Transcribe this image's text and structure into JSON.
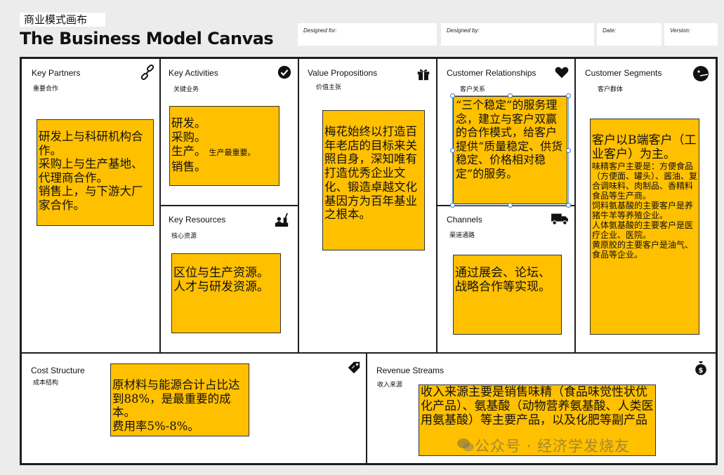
{
  "header": {
    "title_cn": "商业模式画布",
    "title_en": "The Business Model Canvas",
    "designed_for": "Designed for:",
    "designed_by": "Designed by:",
    "date": "Date:",
    "version": "Version:"
  },
  "sections": {
    "key_partners": {
      "title": "Key Partners",
      "cn": "重要合作",
      "icon": "link-icon"
    },
    "key_activities": {
      "title": "Key Activities",
      "cn": "关键业务",
      "icon": "check-circle-icon"
    },
    "key_resources": {
      "title": "Key Resources",
      "cn": "核心资源",
      "icon": "factory-worker-icon"
    },
    "value_propositions": {
      "title": "Value Propositions",
      "cn": "价值主张",
      "icon": "gift-icon"
    },
    "customer_relationships": {
      "title": "Customer Relationships",
      "cn": "客户关系",
      "icon": "heart-icon"
    },
    "channels": {
      "title": "Channels",
      "cn": "渠道通路",
      "icon": "truck-icon"
    },
    "customer_segments": {
      "title": "Customer Segments",
      "cn": "客户群体",
      "icon": "face-icon"
    },
    "cost_structure": {
      "title": "Cost Structure",
      "cn": "成本结构",
      "icon": "tag-icon"
    },
    "revenue_streams": {
      "title": "Revenue Streams",
      "cn": "收入来源",
      "icon": "money-bag-icon"
    }
  },
  "notes": {
    "key_partners": [
      "研发上与科研机构合作。",
      "采购上与生产基地、代理商合作。",
      "销售上，与下游大厂家合作。"
    ],
    "key_activities": [
      "研发。",
      "采购。",
      "生产。",
      "销售。"
    ],
    "key_activities_side": "生产最重要。",
    "key_resources": [
      "区位与生产资源。",
      "人才与研发资源。"
    ],
    "value_propositions": "梅花始终以打造百年老店的目标来关照自身，深知唯有打造优秀企业文化、锻造卓越文化基因方为百年基业之根本。",
    "customer_relationships": "“三个稳定”的服务理念，建立与客户双赢的合作模式，给客户提供“质量稳定、供货稳定、价格相对稳定”的服务。",
    "channels": "通过展会、论坛、战略合作等实现。",
    "customer_segments_head": "客户以B端客户（工业客户）为主。",
    "customer_segments_body": [
      "味精客户主要是：方便食品（方便面、罐头）、酱油、复合调味料、肉制品、香精料食品等生产商。",
      "饲料氨基酸的主要客户是养猪牛羊等养殖企业。",
      "人体氨基酸的主要客户是医疗企业、医院。",
      "黄原胶的主要客户是油气、食品等企业。"
    ],
    "cost_structure": [
      "原材料与能源合计占比达到88%，是最重要的成本。",
      "费用率5%-8%。"
    ],
    "revenue_streams": "收入来源主要是销售味精（食品味觉性状优化产品）、氨基酸（动物营养氨基酸、人类医用氨基酸）等主要产品，以及化肥等副产品"
  },
  "watermark": "公众号 · 经济学发烧友",
  "colors": {
    "note": "#ffc000",
    "border": "#1e1e1e",
    "selection": "#5b9be0"
  }
}
